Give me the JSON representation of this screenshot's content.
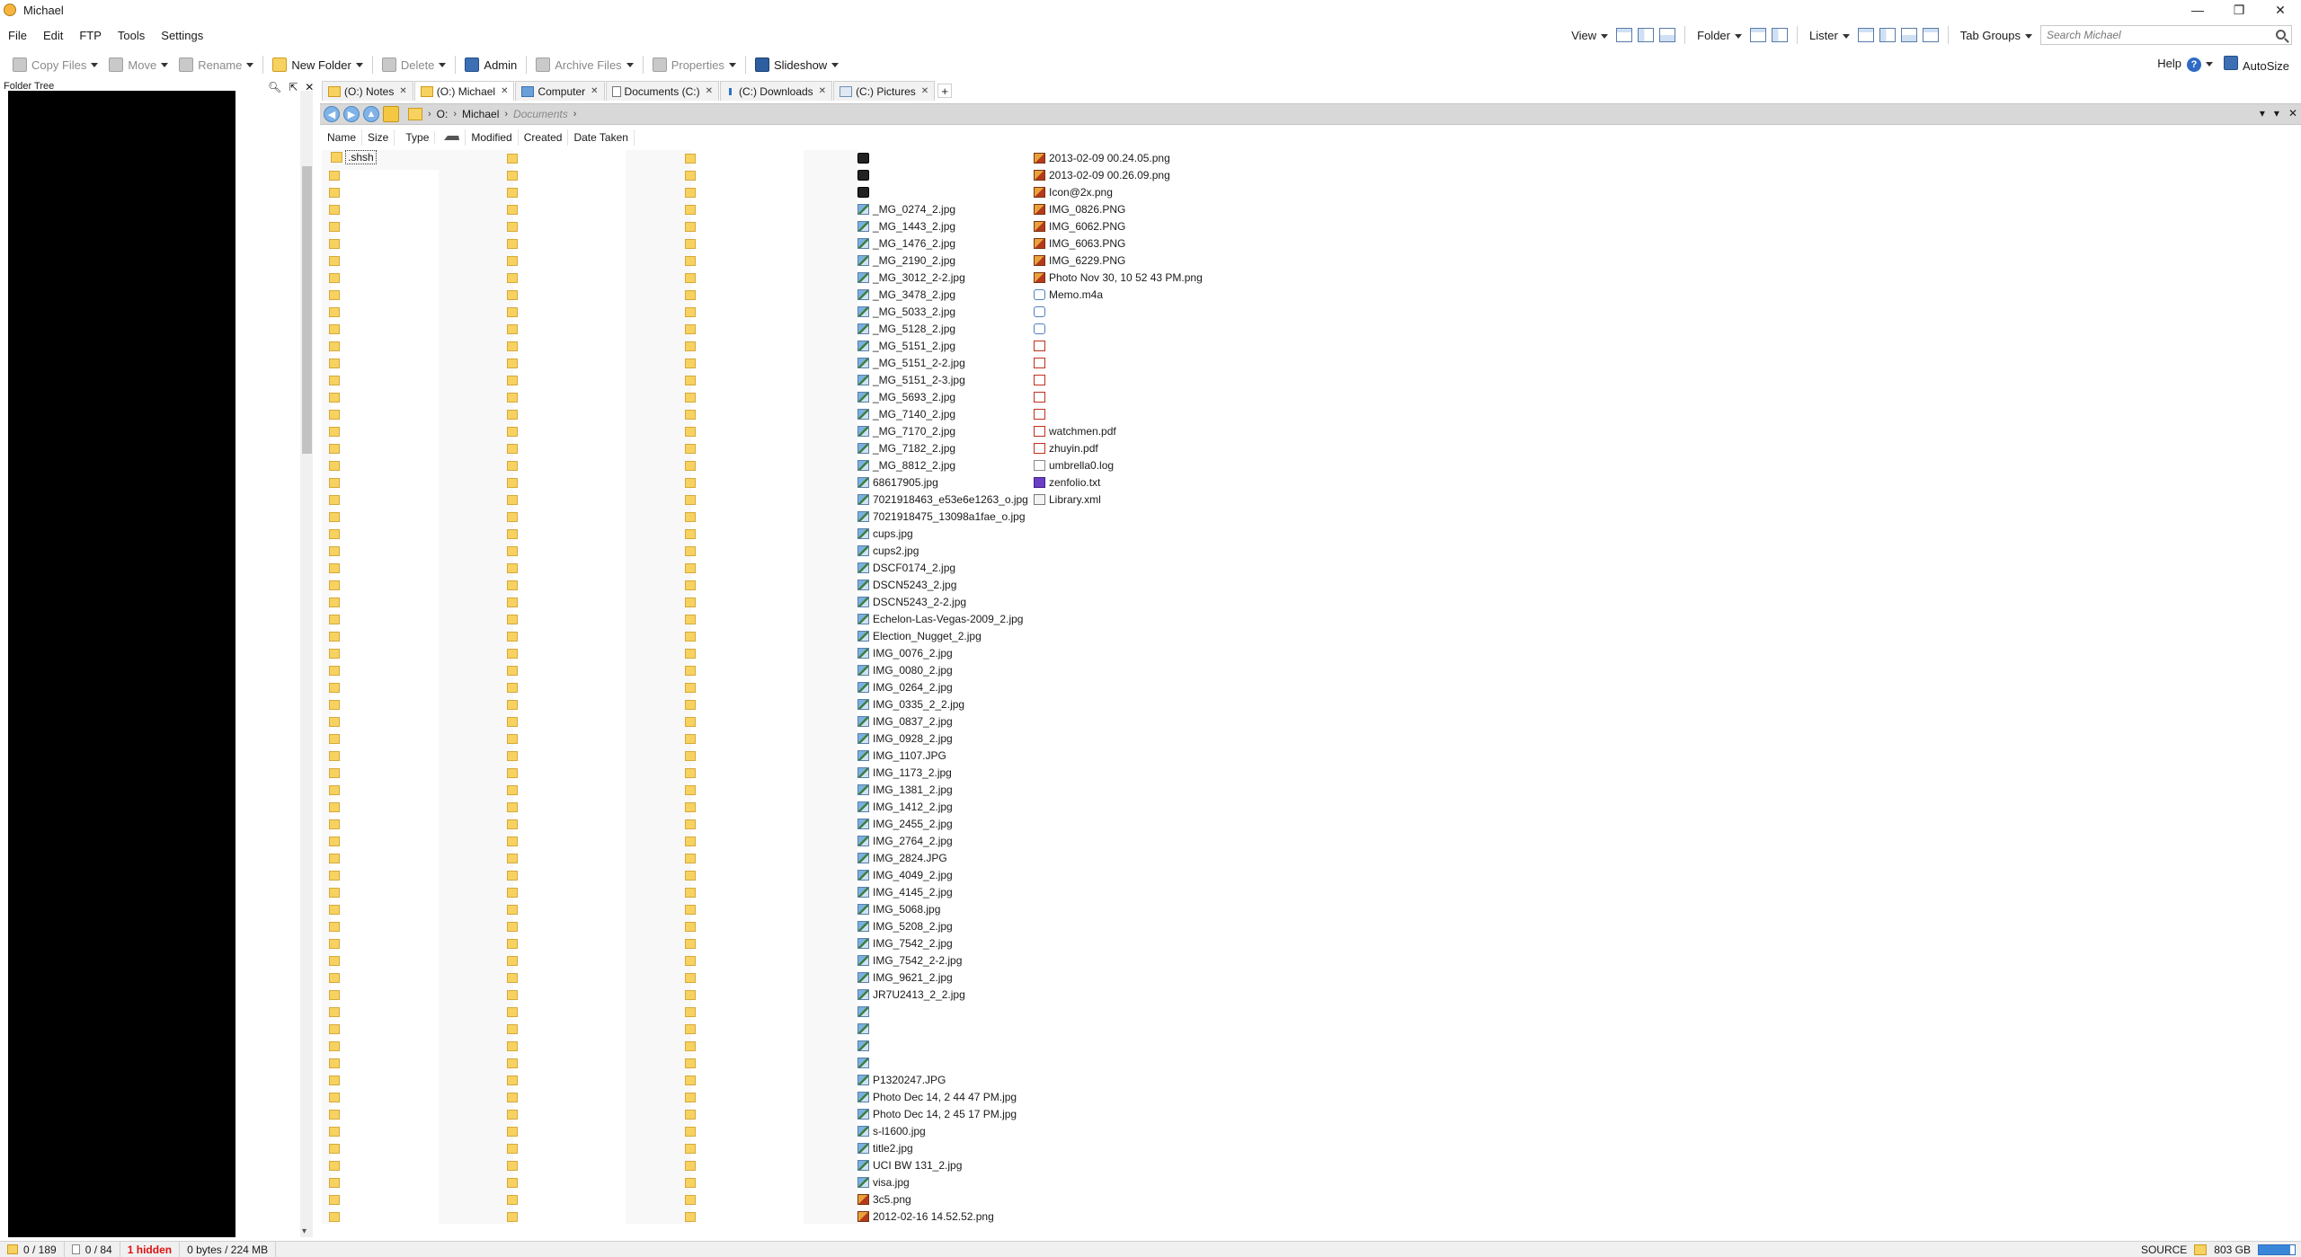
{
  "window": {
    "title": "Michael",
    "min": "—",
    "max": "❐",
    "close": "✕"
  },
  "menu": [
    "File",
    "Edit",
    "FTP",
    "Tools",
    "Settings"
  ],
  "menu_underline": [
    "F",
    "E",
    "F",
    "T",
    "S"
  ],
  "top_right": {
    "view": "View",
    "folder": "Folder",
    "lister": "Lister",
    "tab_groups": "Tab Groups",
    "search_placeholder": "Search Michael"
  },
  "toolbar": {
    "copy": "Copy Files",
    "move": "Move",
    "rename": "Rename",
    "new_folder": "New Folder",
    "delete": "Delete",
    "admin": "Admin",
    "archive": "Archive Files",
    "properties": "Properties",
    "slideshow": "Slideshow",
    "help": "Help",
    "help_q": "?",
    "autosize": "AutoSize"
  },
  "tree": {
    "title": "Folder Tree"
  },
  "tabs": [
    {
      "label": "(O:) Notes",
      "icon": "folder"
    },
    {
      "label": "(O:) Michael",
      "icon": "folder",
      "active": true
    },
    {
      "label": "Computer",
      "icon": "pc"
    },
    {
      "label": "Documents (C:)",
      "icon": "doc"
    },
    {
      "label": "(C:) Downloads",
      "icon": "dl"
    },
    {
      "label": "(C:) Pictures",
      "icon": "pic"
    }
  ],
  "path": {
    "drive": "O:",
    "folder": "Michael",
    "ghost": "Documents"
  },
  "columns": [
    "Name",
    "Size",
    "Type",
    "Modified",
    "Created",
    "Date Taken"
  ],
  "first_item": ".shsh",
  "col3_files": [
    {
      "n": "",
      "i": "dark"
    },
    {
      "n": "",
      "i": "dark"
    },
    {
      "n": "",
      "i": "dark"
    },
    {
      "n": "_MG_0274_2.jpg",
      "i": "img"
    },
    {
      "n": "_MG_1443_2.jpg",
      "i": "img"
    },
    {
      "n": "_MG_1476_2.jpg",
      "i": "img"
    },
    {
      "n": "_MG_2190_2.jpg",
      "i": "img"
    },
    {
      "n": "_MG_3012_2-2.jpg",
      "i": "img"
    },
    {
      "n": "_MG_3478_2.jpg",
      "i": "img"
    },
    {
      "n": "_MG_5033_2.jpg",
      "i": "img"
    },
    {
      "n": "_MG_5128_2.jpg",
      "i": "img"
    },
    {
      "n": "_MG_5151_2.jpg",
      "i": "img"
    },
    {
      "n": "_MG_5151_2-2.jpg",
      "i": "img"
    },
    {
      "n": "_MG_5151_2-3.jpg",
      "i": "img"
    },
    {
      "n": "_MG_5693_2.jpg",
      "i": "img"
    },
    {
      "n": "_MG_7140_2.jpg",
      "i": "img"
    },
    {
      "n": "_MG_7170_2.jpg",
      "i": "img"
    },
    {
      "n": "_MG_7182_2.jpg",
      "i": "img"
    },
    {
      "n": "_MG_8812_2.jpg",
      "i": "img"
    },
    {
      "n": "68617905.jpg",
      "i": "img"
    },
    {
      "n": "7021918463_e53e6e1263_o.jpg",
      "i": "img"
    },
    {
      "n": "7021918475_13098a1fae_o.jpg",
      "i": "img"
    },
    {
      "n": "cups.jpg",
      "i": "img"
    },
    {
      "n": "cups2.jpg",
      "i": "img"
    },
    {
      "n": "DSCF0174_2.jpg",
      "i": "img"
    },
    {
      "n": "DSCN5243_2.jpg",
      "i": "img"
    },
    {
      "n": "DSCN5243_2-2.jpg",
      "i": "img"
    },
    {
      "n": "Echelon-Las-Vegas-2009_2.jpg",
      "i": "img"
    },
    {
      "n": "Election_Nugget_2.jpg",
      "i": "img"
    },
    {
      "n": "IMG_0076_2.jpg",
      "i": "img"
    },
    {
      "n": "IMG_0080_2.jpg",
      "i": "img"
    },
    {
      "n": "IMG_0264_2.jpg",
      "i": "img"
    },
    {
      "n": "IMG_0335_2_2.jpg",
      "i": "img"
    },
    {
      "n": "IMG_0837_2.jpg",
      "i": "img"
    },
    {
      "n": "IMG_0928_2.jpg",
      "i": "img"
    },
    {
      "n": "IMG_1107.JPG",
      "i": "img"
    },
    {
      "n": "IMG_1173_2.jpg",
      "i": "img"
    },
    {
      "n": "IMG_1381_2.jpg",
      "i": "img"
    },
    {
      "n": "IMG_1412_2.jpg",
      "i": "img"
    },
    {
      "n": "IMG_2455_2.jpg",
      "i": "img"
    },
    {
      "n": "IMG_2764_2.jpg",
      "i": "img"
    },
    {
      "n": "IMG_2824.JPG",
      "i": "img"
    },
    {
      "n": "IMG_4049_2.jpg",
      "i": "img"
    },
    {
      "n": "IMG_4145_2.jpg",
      "i": "img"
    },
    {
      "n": "IMG_5068.jpg",
      "i": "img"
    },
    {
      "n": "IMG_5208_2.jpg",
      "i": "img"
    },
    {
      "n": "IMG_7542_2.jpg",
      "i": "img"
    },
    {
      "n": "IMG_7542_2-2.jpg",
      "i": "img"
    },
    {
      "n": "IMG_9621_2.jpg",
      "i": "img"
    },
    {
      "n": "JR7U2413_2_2.jpg",
      "i": "img"
    },
    {
      "n": "",
      "i": "img"
    },
    {
      "n": "",
      "i": "img"
    },
    {
      "n": "",
      "i": "img"
    },
    {
      "n": "",
      "i": "img"
    },
    {
      "n": "P1320247.JPG",
      "i": "img"
    },
    {
      "n": "Photo Dec 14, 2 44 47 PM.jpg",
      "i": "img"
    },
    {
      "n": "Photo Dec 14, 2 45 17 PM.jpg",
      "i": "img"
    },
    {
      "n": "s-l1600.jpg",
      "i": "img"
    },
    {
      "n": "title2.jpg",
      "i": "img"
    },
    {
      "n": "UCI BW 131_2.jpg",
      "i": "img"
    },
    {
      "n": "visa.jpg",
      "i": "img"
    },
    {
      "n": "3c5.png",
      "i": "png"
    },
    {
      "n": "2012-02-16 14.52.52.png",
      "i": "png"
    }
  ],
  "col4_files": [
    {
      "n": "2013-02-09 00.24.05.png",
      "i": "png"
    },
    {
      "n": "2013-02-09 00.26.09.png",
      "i": "png"
    },
    {
      "n": "Icon@2x.png",
      "i": "png"
    },
    {
      "n": "IMG_0826.PNG",
      "i": "png"
    },
    {
      "n": "IMG_6062.PNG",
      "i": "png"
    },
    {
      "n": "IMG_6063.PNG",
      "i": "png"
    },
    {
      "n": "IMG_6229.PNG",
      "i": "png"
    },
    {
      "n": "Photo Nov 30, 10 52 43 PM.png",
      "i": "png"
    },
    {
      "n": "Memo.m4a",
      "i": "audio"
    },
    {
      "n": "",
      "i": "audio"
    },
    {
      "n": "",
      "i": "audio"
    },
    {
      "n": "",
      "i": "pdf"
    },
    {
      "n": "",
      "i": "pdf"
    },
    {
      "n": "",
      "i": "pdf"
    },
    {
      "n": "",
      "i": "pdf"
    },
    {
      "n": "",
      "i": "pdf"
    },
    {
      "n": "watchmen.pdf",
      "i": "pdf"
    },
    {
      "n": "zhuyin.pdf",
      "i": "pdf"
    },
    {
      "n": "umbrella0.log",
      "i": "log"
    },
    {
      "n": "zenfolio.txt",
      "i": "txt"
    },
    {
      "n": "Library.xml",
      "i": "xml"
    }
  ],
  "status": {
    "folders": "0 / 189",
    "files": "0 / 84",
    "hidden": "1 hidden",
    "bytes": "0 bytes / 224 MB",
    "source": "SOURCE",
    "free": "803 GB"
  }
}
